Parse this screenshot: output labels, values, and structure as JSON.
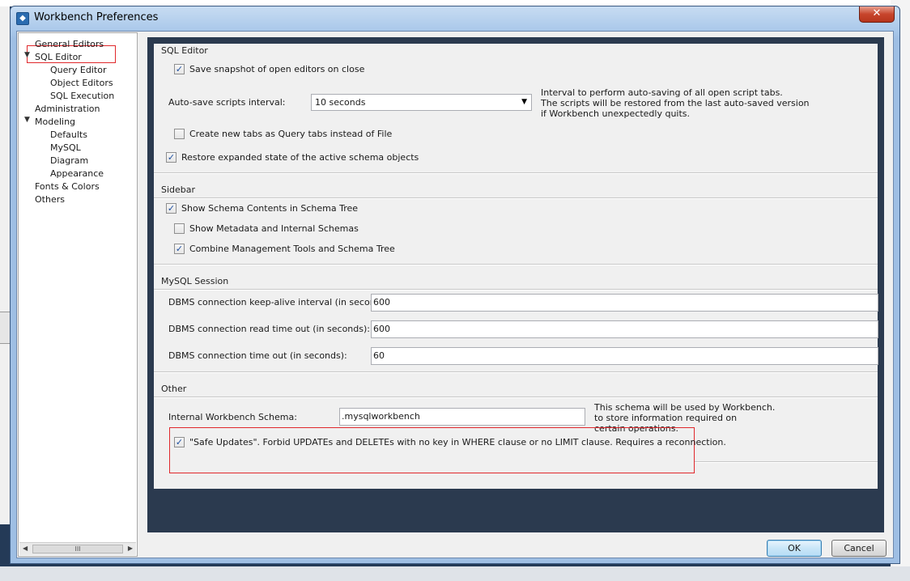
{
  "window": {
    "title": "Workbench Preferences",
    "close_glyph": "✕"
  },
  "tree": {
    "items": [
      {
        "label": "General Editors"
      },
      {
        "label": "SQL Editor",
        "expanded": true
      },
      {
        "label": "Query Editor"
      },
      {
        "label": "Object Editors"
      },
      {
        "label": "SQL Execution"
      },
      {
        "label": "Administration"
      },
      {
        "label": "Modeling",
        "expanded": true
      },
      {
        "label": "Defaults"
      },
      {
        "label": "MySQL"
      },
      {
        "label": "Diagram"
      },
      {
        "label": "Appearance"
      },
      {
        "label": "Fonts & Colors"
      },
      {
        "label": "Others"
      }
    ],
    "scroll_thumb": "III"
  },
  "sql_editor": {
    "title": "SQL Editor",
    "save_snapshot": {
      "label": "Save snapshot of open editors on close",
      "checked": true
    },
    "autosave_label": "Auto-save scripts interval:",
    "autosave_value": "10 seconds",
    "autosave_help": [
      "Interval to perform auto-saving of all open script tabs.",
      "The scripts will be restored from the last auto-saved version",
      "if Workbench unexpectedly quits."
    ],
    "query_tabs": {
      "label": "Create new tabs as Query tabs instead of File",
      "checked": false
    },
    "restore_state": {
      "label": "Restore expanded state of the active schema objects",
      "checked": true
    }
  },
  "sidebar": {
    "title": "Sidebar",
    "schema_contents": {
      "label": "Show Schema Contents in Schema Tree",
      "checked": true
    },
    "metadata": {
      "label": "Show Metadata and Internal Schemas",
      "checked": false
    },
    "combine_tools": {
      "label": "Combine Management Tools and Schema Tree",
      "checked": true
    }
  },
  "session": {
    "title": "MySQL Session",
    "keepalive_label": "DBMS connection keep-alive interval (in seconds):",
    "keepalive_value": "600",
    "read_timeout_label": "DBMS connection read time out (in seconds):",
    "read_timeout_value": "600",
    "conn_timeout_label": "DBMS connection time out (in seconds):",
    "conn_timeout_value": "60"
  },
  "other": {
    "title": "Other",
    "schema_label": "Internal Workbench Schema:",
    "schema_value": ".mysqlworkbench",
    "schema_help": [
      "This schema will be used by Workbench.",
      "to store information required on",
      "certain operations."
    ],
    "safe_updates": {
      "label": "\"Safe Updates\". Forbid UPDATEs and DELETEs with no key in WHERE clause or no LIMIT clause. Requires a reconnection.",
      "checked": true
    }
  },
  "buttons": {
    "ok": "OK",
    "cancel": "Cancel"
  },
  "icons": {
    "check": "✓",
    "dropdown": "▼",
    "expanded": "◢"
  }
}
